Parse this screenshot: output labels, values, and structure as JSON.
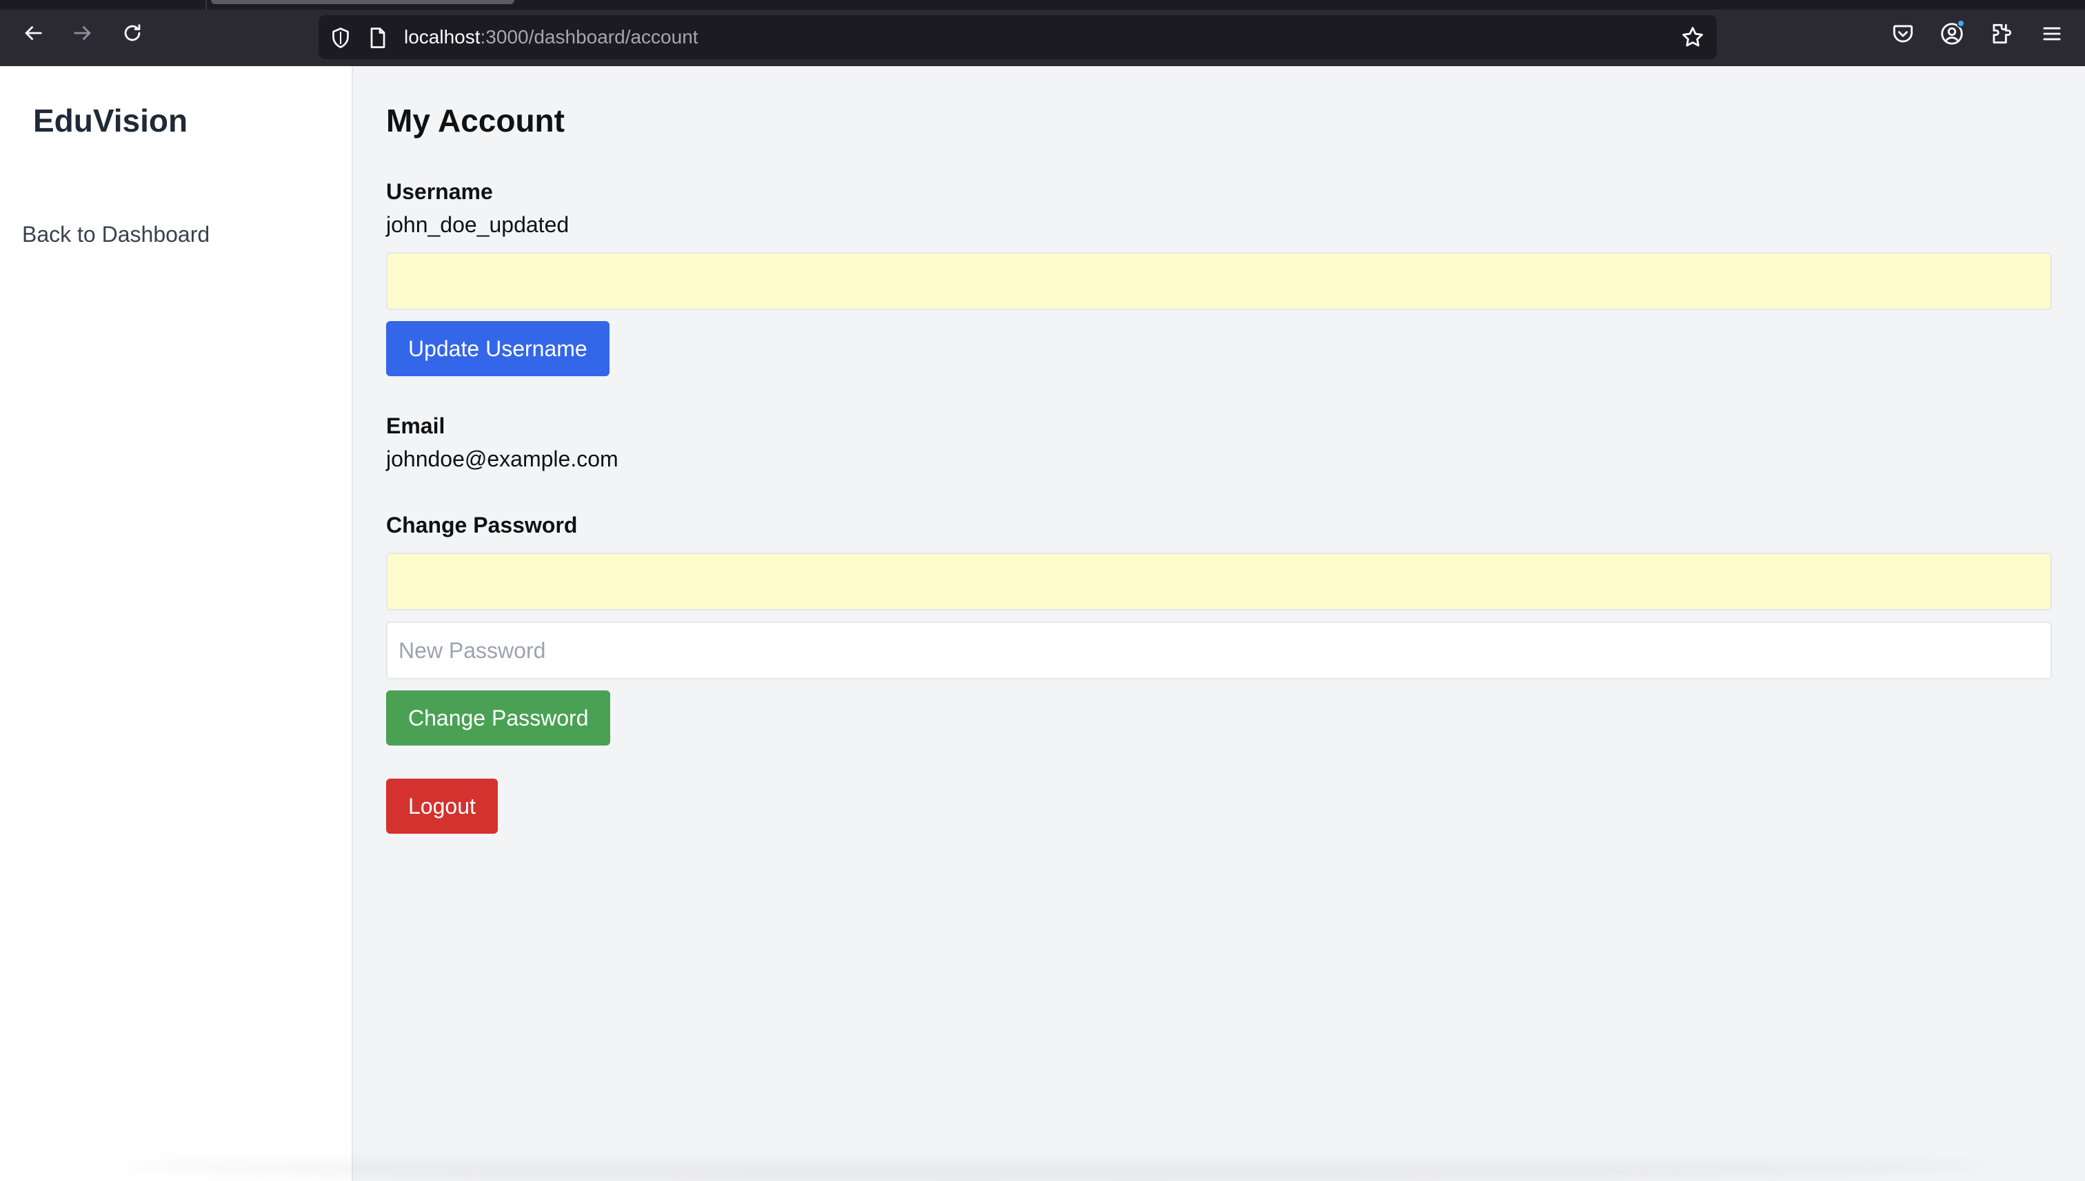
{
  "browser": {
    "url_host": "localhost",
    "url_path": ":3000/dashboard/account"
  },
  "sidebar": {
    "brand": "EduVision",
    "back_link": "Back to Dashboard"
  },
  "main": {
    "title": "My Account",
    "username": {
      "label": "Username",
      "value": "john_doe_updated",
      "input_value": "",
      "button": "Update Username"
    },
    "email": {
      "label": "Email",
      "value": "johndoe@example.com"
    },
    "password": {
      "label": "Change Password",
      "current_input_value": "",
      "new_placeholder": "New Password",
      "button": "Change Password"
    },
    "logout_button": "Logout"
  },
  "colors": {
    "update_button": "#3366e8",
    "change_password_button": "#4aa154",
    "logout_button": "#d3322f",
    "autofill_background": "#fefccc"
  },
  "icons": {
    "back": "arrow-left-icon",
    "forward": "arrow-right-icon",
    "reload": "reload-icon",
    "shield": "shield-icon",
    "page": "page-icon",
    "bookmark": "star-icon",
    "pocket": "pocket-icon",
    "account": "account-icon",
    "extensions": "puzzle-icon",
    "menu": "hamburger-menu-icon"
  }
}
